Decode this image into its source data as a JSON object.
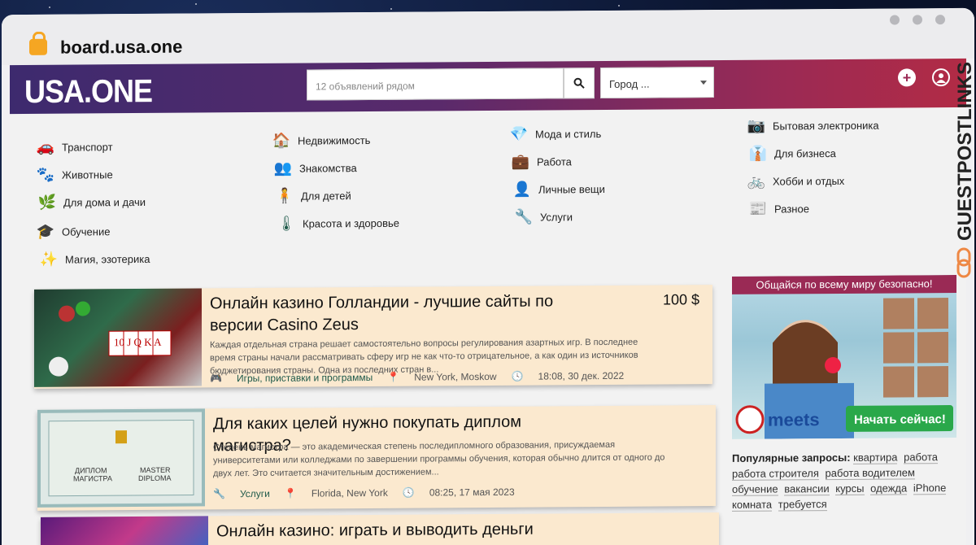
{
  "browser": {
    "url": "board.usa.one"
  },
  "header": {
    "logo": "USA.ONE",
    "search_placeholder": "12 объявлений рядом",
    "city": "Город ..."
  },
  "categories": [
    {
      "label": "Транспорт",
      "icon": "car-icon"
    },
    {
      "label": "Животные",
      "icon": "paw-icon"
    },
    {
      "label": "Для дома и дачи",
      "icon": "plant-icon"
    },
    {
      "label": "Обучение",
      "icon": "graduation-cap-icon"
    },
    {
      "label": "Магия, эзотерика",
      "icon": "magic-wand-icon"
    },
    {
      "label": "Недвижимость",
      "icon": "home-icon"
    },
    {
      "label": "Знакомства",
      "icon": "users-icon"
    },
    {
      "label": "Для детей",
      "icon": "child-icon"
    },
    {
      "label": "Красота и здоровье",
      "icon": "health-icon"
    },
    {
      "label": "Мода и стиль",
      "icon": "diamond-icon"
    },
    {
      "label": "Работа",
      "icon": "briefcase-icon"
    },
    {
      "label": "Личные вещи",
      "icon": "user-icon"
    },
    {
      "label": "Услуги",
      "icon": "wrench-icon"
    },
    {
      "label": "Бытовая электроника",
      "icon": "camera-icon"
    },
    {
      "label": "Для бизнеса",
      "icon": "tie-icon"
    },
    {
      "label": "Хобби и отдых",
      "icon": "bicycle-icon"
    },
    {
      "label": "Разное",
      "icon": "newspaper-icon"
    }
  ],
  "listings": [
    {
      "title": "Онлайн казино Голландии - лучшие сайты по версии Casino Zeus",
      "price": "100 $",
      "description": "Каждая отдельная страна решает самостоятельно вопросы регулирования азартных игр. В последнее время страны начали рассматривать сферу игр не как что-то отрицательное, а как один из источников бюджетирования страны. Одна из последних стран в...",
      "category": "Игры, приставки и программы",
      "location": "New York, Moskow",
      "date": "18:08, 30 дек. 2022"
    },
    {
      "title": "Для каких целей нужно покупать диплом магистра?",
      "price": "",
      "description": "Степень магистра — это академическая степень последипломного образования, присуждаемая университетами или колледжами по завершении программы обучения, которая обычно длится от одного до двух лет. Это считается значительным достижением...",
      "category": "Услуги",
      "location": "Florida, New York",
      "date": "08:25, 17 мая 2023"
    },
    {
      "title": "Онлайн казино: играть и выводить деньги моментально",
      "price": "",
      "description": "",
      "category": "",
      "location": "",
      "date": ""
    }
  ],
  "thumb_text": {
    "diploma_line1": "ДИПЛОМ",
    "diploma_line2": "МАГИСТРА",
    "master_line1": "MASTER",
    "master_line2": "DIPLOMA"
  },
  "ad": {
    "headline": "Общайся по всему миру безопасно!",
    "brand": "meets",
    "cta": "Начать сейчас!"
  },
  "popular": {
    "label": "Популярные запросы:",
    "tags": [
      "квартира",
      "работа",
      "работа строителя",
      "работа водителем",
      "обучение",
      "вакансии",
      "курсы",
      "одежда",
      "iPhone",
      "комната",
      "требуется"
    ]
  },
  "watermark": "GUESTPOSTLINKS",
  "colors": {
    "accent": "#1f5a4a",
    "header_start": "#3d2a6e",
    "header_end": "#b22b45",
    "card_bg": "#fbe9cf"
  }
}
